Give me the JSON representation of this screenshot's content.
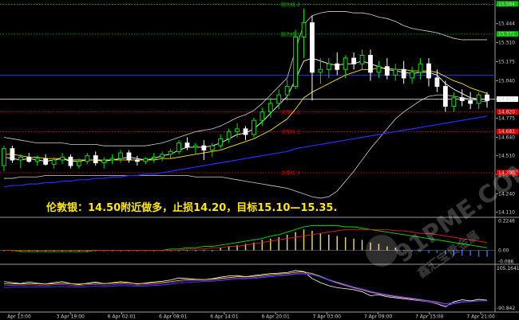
{
  "chart_data": {
    "type": "candlestick",
    "price_axis": {
      "ticks": [
        "15.575",
        "15.444",
        "15.310",
        "15.175",
        "15.040",
        "14.910",
        "14.775",
        "14.640",
        "14.510",
        "14.375",
        "14.240",
        "14.110"
      ],
      "ylim": [
        14.08,
        15.6
      ]
    },
    "time_axis": {
      "labels": [
        "Apr 13:00",
        "3 Apr 19:00",
        "6 Apr 02:01",
        "6 Apr 08:01",
        "6 Apr 14:01",
        "6 Apr 20:01",
        "7 Apr 03:00",
        "7 Apr 09:00",
        "7 Apr 15:00",
        "7 Apr 21:00"
      ]
    },
    "price_highlights": [
      {
        "value": "15.584",
        "color": "#00c000"
      },
      {
        "value": "15.371",
        "color": "#00c000"
      },
      {
        "value": "14.910",
        "color": "#ffffff"
      },
      {
        "value": "14.820",
        "color": "#e00000"
      },
      {
        "value": "14.681",
        "color": "#e00000"
      },
      {
        "value": "14.390",
        "color": "#e00000"
      }
    ],
    "levels": [
      {
        "label": "阻力线 2",
        "value": 15.58,
        "color": "#00c000"
      },
      {
        "label": "阻力线 1",
        "value": 15.37,
        "color": "#00c000"
      },
      {
        "label": "支撑线 1",
        "value": 14.82,
        "color": "#e00000"
      },
      {
        "label": "支撑线 2",
        "value": 14.68,
        "color": "#e00000"
      },
      {
        "label": "支撑线 3",
        "value": 14.39,
        "color": "#e00000"
      },
      {
        "label": "",
        "value": 15.08,
        "color": "#2030ff"
      },
      {
        "label": "",
        "value": 14.91,
        "color": "#c8c8c8"
      }
    ],
    "candles": [
      [
        14.44,
        14.58,
        14.4,
        14.56
      ],
      [
        14.56,
        14.58,
        14.46,
        14.48
      ],
      [
        14.48,
        14.52,
        14.42,
        14.5
      ],
      [
        14.5,
        14.53,
        14.46,
        14.47
      ],
      [
        14.47,
        14.51,
        14.44,
        14.49
      ],
      [
        14.49,
        14.52,
        14.44,
        14.45
      ],
      [
        14.45,
        14.5,
        14.42,
        14.48
      ],
      [
        14.48,
        14.53,
        14.45,
        14.5
      ],
      [
        14.5,
        14.52,
        14.42,
        14.44
      ],
      [
        14.44,
        14.49,
        14.42,
        14.47
      ],
      [
        14.47,
        14.53,
        14.45,
        14.51
      ],
      [
        14.51,
        14.54,
        14.44,
        14.46
      ],
      [
        14.46,
        14.5,
        14.42,
        14.48
      ],
      [
        14.48,
        14.52,
        14.45,
        14.49
      ],
      [
        14.49,
        14.55,
        14.46,
        14.53
      ],
      [
        14.53,
        14.55,
        14.46,
        14.48
      ],
      [
        14.48,
        14.51,
        14.44,
        14.47
      ],
      [
        14.47,
        14.5,
        14.45,
        14.49
      ],
      [
        14.49,
        14.53,
        14.46,
        14.5
      ],
      [
        14.5,
        14.54,
        14.47,
        14.52
      ],
      [
        14.52,
        14.56,
        14.49,
        14.54
      ],
      [
        14.54,
        14.62,
        14.52,
        14.6
      ],
      [
        14.6,
        14.64,
        14.55,
        14.57
      ],
      [
        14.57,
        14.6,
        14.52,
        14.58
      ],
      [
        14.58,
        14.62,
        14.48,
        14.55
      ],
      [
        14.55,
        14.6,
        14.5,
        14.58
      ],
      [
        14.58,
        14.66,
        14.56,
        14.63
      ],
      [
        14.63,
        14.7,
        14.6,
        14.68
      ],
      [
        14.68,
        14.74,
        14.64,
        14.7
      ],
      [
        14.7,
        14.72,
        14.62,
        14.66
      ],
      [
        14.66,
        14.78,
        14.64,
        14.76
      ],
      [
        14.76,
        14.85,
        14.72,
        14.82
      ],
      [
        14.82,
        14.92,
        14.78,
        14.88
      ],
      [
        14.88,
        14.98,
        14.84,
        14.94
      ],
      [
        14.94,
        15.05,
        14.9,
        15.0
      ],
      [
        15.0,
        15.4,
        14.98,
        15.35
      ],
      [
        15.35,
        15.55,
        15.2,
        15.45
      ],
      [
        15.45,
        15.5,
        14.9,
        15.1
      ],
      [
        15.1,
        15.2,
        15.02,
        15.12
      ],
      [
        15.12,
        15.2,
        15.06,
        15.16
      ],
      [
        15.16,
        15.24,
        15.08,
        15.12
      ],
      [
        15.12,
        15.22,
        15.06,
        15.2
      ],
      [
        15.2,
        15.24,
        15.12,
        15.16
      ],
      [
        15.16,
        15.26,
        15.12,
        15.22
      ],
      [
        15.22,
        15.26,
        15.04,
        15.1
      ],
      [
        15.1,
        15.18,
        15.06,
        15.14
      ],
      [
        15.14,
        15.2,
        15.05,
        15.08
      ],
      [
        15.08,
        15.16,
        15.04,
        15.12
      ],
      [
        15.12,
        15.18,
        15.02,
        15.06
      ],
      [
        15.06,
        15.14,
        15.02,
        15.1
      ],
      [
        15.1,
        15.2,
        15.05,
        15.16
      ],
      [
        15.16,
        15.2,
        15.0,
        15.06
      ],
      [
        15.06,
        15.12,
        14.96,
        15.0
      ],
      [
        15.0,
        15.04,
        14.82,
        14.86
      ],
      [
        14.86,
        14.96,
        14.82,
        14.92
      ],
      [
        14.92,
        14.98,
        14.86,
        14.9
      ],
      [
        14.9,
        14.96,
        14.84,
        14.88
      ],
      [
        14.88,
        14.96,
        14.84,
        14.94
      ],
      [
        14.94,
        14.96,
        14.85,
        14.9
      ]
    ],
    "moving_averages": [
      {
        "color": "#ffffff",
        "values": [
          14.5,
          14.49,
          14.48,
          14.49,
          14.48,
          14.47,
          14.48,
          14.49,
          14.47,
          14.47,
          14.48,
          14.48,
          14.47,
          14.48,
          14.49,
          14.5,
          14.49,
          14.48,
          14.49,
          14.51,
          14.52,
          14.55,
          14.57,
          14.57,
          14.57,
          14.58,
          14.6,
          14.63,
          14.66,
          14.67,
          14.7,
          14.75,
          14.81,
          14.87,
          14.93,
          15.05,
          15.18,
          15.2,
          15.18,
          15.16,
          15.15,
          15.16,
          15.16,
          15.18,
          15.16,
          15.14,
          15.12,
          15.11,
          15.1,
          15.09,
          15.1,
          15.1,
          15.08,
          15.02,
          14.98,
          14.95,
          14.92,
          14.91,
          14.91
        ]
      },
      {
        "color": "#ffe800",
        "values": [
          14.52,
          14.52,
          14.51,
          14.5,
          14.5,
          14.49,
          14.49,
          14.49,
          14.48,
          14.48,
          14.48,
          14.48,
          14.48,
          14.48,
          14.48,
          14.48,
          14.48,
          14.48,
          14.48,
          14.49,
          14.49,
          14.5,
          14.51,
          14.52,
          14.53,
          14.54,
          14.55,
          14.57,
          14.59,
          14.61,
          14.63,
          14.66,
          14.69,
          14.73,
          14.77,
          14.84,
          14.92,
          14.96,
          14.99,
          15.02,
          15.05,
          15.08,
          15.1,
          15.12,
          15.12,
          15.13,
          15.13,
          15.12,
          15.12,
          15.11,
          15.11,
          15.11,
          15.1,
          15.07,
          15.04,
          15.02,
          14.99,
          14.97,
          14.95
        ]
      },
      {
        "color": "#2030ff",
        "values": [
          14.29,
          14.3,
          14.3,
          14.31,
          14.31,
          14.32,
          14.32,
          14.33,
          14.33,
          14.34,
          14.34,
          14.35,
          14.35,
          14.36,
          14.36,
          14.37,
          14.37,
          14.38,
          14.38,
          14.39,
          14.4,
          14.41,
          14.42,
          14.43,
          14.44,
          14.45,
          14.46,
          14.47,
          14.48,
          14.49,
          14.5,
          14.51,
          14.52,
          14.53,
          14.54,
          14.56,
          14.57,
          14.58,
          14.59,
          14.6,
          14.61,
          14.62,
          14.63,
          14.64,
          14.65,
          14.66,
          14.67,
          14.68,
          14.69,
          14.7,
          14.71,
          14.72,
          14.73,
          14.74,
          14.75,
          14.76,
          14.77,
          14.78,
          14.79
        ]
      }
    ],
    "bands": {
      "color": "#cfcfcf",
      "upper": [
        14.64,
        14.63,
        14.62,
        14.61,
        14.6,
        14.6,
        14.6,
        14.6,
        14.59,
        14.59,
        14.59,
        14.59,
        14.58,
        14.58,
        14.58,
        14.58,
        14.58,
        14.58,
        14.59,
        14.6,
        14.62,
        14.64,
        14.66,
        14.68,
        14.69,
        14.7,
        14.72,
        14.75,
        14.78,
        14.8,
        14.83,
        14.88,
        14.94,
        15.0,
        15.06,
        15.26,
        15.44,
        15.5,
        15.52,
        15.53,
        15.53,
        15.53,
        15.52,
        15.52,
        15.51,
        15.49,
        15.48,
        15.46,
        15.43,
        15.41,
        15.4,
        15.39,
        15.38,
        15.36,
        15.34,
        15.33,
        15.33,
        15.33,
        15.33
      ],
      "lower": [
        14.35,
        14.35,
        14.36,
        14.36,
        14.36,
        14.37,
        14.37,
        14.37,
        14.37,
        14.37,
        14.37,
        14.37,
        14.37,
        14.37,
        14.37,
        14.37,
        14.37,
        14.37,
        14.37,
        14.37,
        14.37,
        14.37,
        14.37,
        14.36,
        14.36,
        14.36,
        14.36,
        14.35,
        14.34,
        14.33,
        14.32,
        14.31,
        14.3,
        14.29,
        14.28,
        14.26,
        14.24,
        14.22,
        14.21,
        14.22,
        14.26,
        14.33,
        14.4,
        14.48,
        14.56,
        14.63,
        14.7,
        14.77,
        14.82,
        14.86,
        14.9,
        14.93,
        14.94,
        14.94,
        14.93,
        14.92,
        14.91,
        14.9,
        14.89
      ]
    },
    "annotation": "伦敦银：14.50附近做多，止损14.20，目标15.10—15.35.",
    "macd": {
      "ticks": [
        "0.2246",
        "0.00",
        "-0.086"
      ],
      "ylim": [
        -0.095,
        0.235
      ],
      "histogram": [
        0.0,
        0.0,
        0.0,
        0.0,
        0.0,
        0.0,
        0.0,
        0.0,
        0.0,
        0.0,
        0.0,
        0.0,
        0.0,
        0.0,
        0.0,
        0.0,
        0.0,
        0.0,
        0.0,
        0.0,
        0.0,
        0.0,
        0.0,
        0.0,
        0.0,
        0.0,
        0.02,
        0.03,
        0.04,
        0.05,
        0.06,
        0.08,
        0.09,
        0.1,
        0.12,
        0.14,
        0.16,
        0.15,
        0.13,
        0.12,
        0.11,
        0.1,
        0.09,
        0.08,
        0.06,
        0.05,
        0.03,
        0.02,
        0.0,
        -0.01,
        -0.01,
        -0.02,
        -0.02,
        -0.03,
        -0.04,
        -0.04,
        -0.04,
        -0.05,
        -0.05
      ],
      "lines": [
        {
          "color": "#00e000",
          "values": [
            0.0,
            0.0,
            -0.01,
            -0.01,
            -0.01,
            -0.01,
            -0.01,
            -0.01,
            -0.01,
            -0.01,
            -0.01,
            0.0,
            0.0,
            0.0,
            0.0,
            0.0,
            0.0,
            0.0,
            0.0,
            0.0,
            0.01,
            0.01,
            0.02,
            0.02,
            0.03,
            0.03,
            0.04,
            0.05,
            0.06,
            0.07,
            0.08,
            0.09,
            0.11,
            0.12,
            0.14,
            0.16,
            0.18,
            0.19,
            0.19,
            0.19,
            0.19,
            0.18,
            0.18,
            0.17,
            0.16,
            0.15,
            0.14,
            0.13,
            0.12,
            0.11,
            0.1,
            0.09,
            0.08,
            0.07,
            0.06,
            0.05,
            0.04,
            0.03,
            0.02
          ]
        },
        {
          "color": "#e02020",
          "values": [
            0.0,
            0.0,
            0.0,
            0.0,
            0.0,
            0.0,
            0.0,
            0.0,
            0.0,
            0.0,
            0.0,
            0.0,
            0.0,
            0.0,
            0.0,
            0.0,
            0.0,
            0.0,
            0.0,
            0.0,
            0.0,
            0.0,
            0.01,
            0.01,
            0.01,
            0.02,
            0.02,
            0.03,
            0.03,
            0.04,
            0.05,
            0.06,
            0.07,
            0.08,
            0.09,
            0.1,
            0.11,
            0.12,
            0.13,
            0.14,
            0.15,
            0.16,
            0.16,
            0.16,
            0.16,
            0.16,
            0.16,
            0.15,
            0.15,
            0.14,
            0.13,
            0.13,
            0.12,
            0.11,
            0.1,
            0.09,
            0.08,
            0.07,
            0.06
          ]
        }
      ]
    },
    "oscillator": {
      "ticks": [
        "105.1641",
        "-90.842"
      ],
      "ylim": [
        -95,
        110
      ],
      "lines": [
        {
          "color": "#ffffff",
          "values": [
            40,
            35,
            30,
            38,
            32,
            28,
            35,
            40,
            30,
            25,
            32,
            38,
            30,
            34,
            40,
            35,
            28,
            33,
            38,
            42,
            48,
            58,
            55,
            52,
            50,
            54,
            62,
            68,
            70,
            64,
            70,
            75,
            80,
            82,
            85,
            95,
            90,
            55,
            35,
            20,
            10,
            5,
            0,
            -10,
            -30,
            -25,
            -35,
            -40,
            -45,
            -50,
            -55,
            -60,
            -70,
            -85,
            -60,
            -50,
            -55,
            -48,
            -52
          ]
        },
        {
          "color": "#ffe800",
          "values": [
            30,
            30,
            28,
            30,
            30,
            28,
            30,
            32,
            30,
            28,
            30,
            32,
            30,
            32,
            34,
            33,
            30,
            31,
            33,
            36,
            40,
            46,
            50,
            50,
            50,
            52,
            56,
            60,
            64,
            64,
            66,
            70,
            74,
            78,
            80,
            86,
            88,
            80,
            66,
            50,
            35,
            22,
            10,
            0,
            -12,
            -20,
            -28,
            -34,
            -40,
            -45,
            -50,
            -55,
            -62,
            -70,
            -65,
            -60,
            -58,
            -55,
            -54
          ]
        },
        {
          "color": "#a020ff",
          "values": [
            20,
            22,
            20,
            24,
            22,
            20,
            24,
            26,
            22,
            20,
            24,
            26,
            22,
            24,
            28,
            26,
            22,
            24,
            26,
            30,
            34,
            40,
            44,
            44,
            44,
            46,
            50,
            54,
            58,
            58,
            60,
            64,
            68,
            72,
            74,
            80,
            82,
            76,
            62,
            46,
            32,
            20,
            8,
            -2,
            -14,
            -22,
            -30,
            -36,
            -42,
            -48,
            -54,
            -60,
            -68,
            -80,
            -70,
            -62,
            -60,
            -56,
            -55
          ]
        },
        {
          "color": "#3050ff",
          "values": [
            10,
            12,
            12,
            14,
            14,
            13,
            15,
            16,
            14,
            13,
            15,
            17,
            15,
            17,
            20,
            19,
            17,
            18,
            20,
            23,
            27,
            32,
            36,
            38,
            40,
            42,
            45,
            49,
            52,
            54,
            56,
            60,
            64,
            68,
            71,
            76,
            78,
            74,
            64,
            50,
            38,
            26,
            14,
            4,
            -8,
            -16,
            -24,
            -30,
            -36,
            -42,
            -48,
            -54,
            -60,
            -70,
            -66,
            -60,
            -58,
            -55,
            -54
          ]
        }
      ]
    }
  },
  "watermark": {
    "brand": "91PME.COM",
    "tagline": "鑫汇宝贵金属"
  }
}
